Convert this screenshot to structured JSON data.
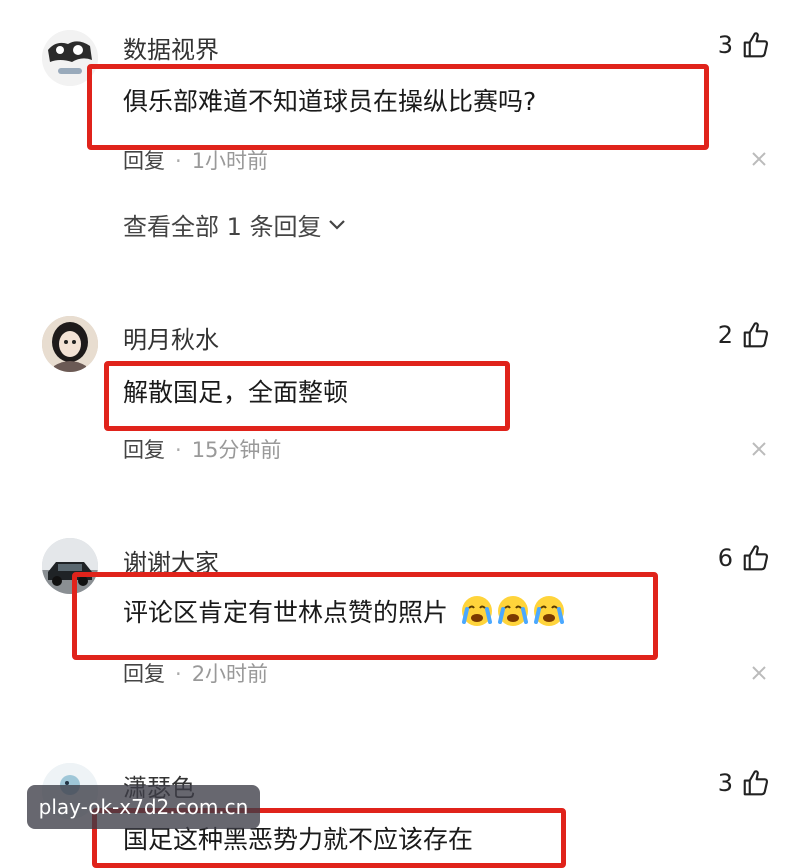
{
  "comments": [
    {
      "username": "数据视界",
      "likes": "3",
      "content": "俱乐部难道不知道球员在操纵比赛吗?",
      "reply_label": "回复",
      "time": "1小时前",
      "view_replies": "查看全部 1 条回复"
    },
    {
      "username": "明月秋水",
      "likes": "2",
      "content": "解散国足，全面整顿",
      "reply_label": "回复",
      "time": "15分钟前"
    },
    {
      "username": "谢谢大家",
      "likes": "6",
      "content": "评论区肯定有世林点赞的照片",
      "reply_label": "回复",
      "time": "2小时前"
    },
    {
      "username": "潇瑟色",
      "likes": "3",
      "content": "国足这种黑恶势力就不应该存在"
    }
  ],
  "watermark": "play-ok-x7d2.com.cn",
  "colors": {
    "highlight_box": "#e0231b",
    "meta_text": "#999999"
  }
}
